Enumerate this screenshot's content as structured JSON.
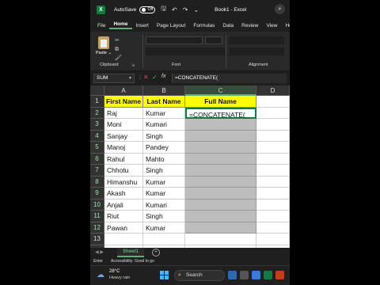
{
  "titlebar": {
    "app_icon": "X",
    "autosave_label": "AutoSave",
    "autosave_state": "Off",
    "book_title": "Book1 - Excel"
  },
  "tabs": [
    "File",
    "Home",
    "Insert",
    "Page Layout",
    "Formulas",
    "Data",
    "Review",
    "View",
    "He"
  ],
  "active_tab": "Home",
  "ribbon": {
    "paste_label": "Paste",
    "clipboard_label": "Clipboard",
    "font_label": "Font",
    "alignment_label": "Alignment"
  },
  "formula_bar": {
    "namebox": "SUM",
    "fx": "fx",
    "content": "=CONCATENATE("
  },
  "columns": [
    "A",
    "B",
    "C",
    "D"
  ],
  "rows": [
    "1",
    "2",
    "3",
    "4",
    "5",
    "6",
    "7",
    "8",
    "9",
    "10",
    "11",
    "12",
    "13",
    "14"
  ],
  "table": {
    "headers": [
      "First Name",
      "Last Name",
      "Full Name"
    ],
    "data": [
      [
        "Raj",
        "Kumar"
      ],
      [
        "Moni",
        "Kumari"
      ],
      [
        "Sanjay",
        "Singh"
      ],
      [
        "Manoj",
        "Pandey"
      ],
      [
        "Rahul",
        "Mahto"
      ],
      [
        "Chhotu",
        "Singh"
      ],
      [
        "Himanshu",
        "Kumar"
      ],
      [
        "Akash",
        "Kumar"
      ],
      [
        "Anjali",
        "Kumari"
      ],
      [
        "Riut",
        "Singh"
      ],
      [
        "Pawan",
        "Kumar"
      ]
    ],
    "active_cell_text": "=CONCATENATE(",
    "tooltip": {
      "fn": "CONCATENATE(",
      "arg1": "text1",
      "rest": ", [text2], ...)"
    }
  },
  "sheet": {
    "tab_label": "Sheet1",
    "add": "+"
  },
  "status": {
    "mode": "Enter",
    "accessibility": "Accessibility: Good to go"
  },
  "taskbar": {
    "temp": "28°C",
    "weather": "Heavy rain",
    "search": "Search"
  },
  "colors": {
    "excel_green": "#107c41",
    "header_fill": "#ffff00",
    "shaded_fill": "#bdbdbd"
  }
}
